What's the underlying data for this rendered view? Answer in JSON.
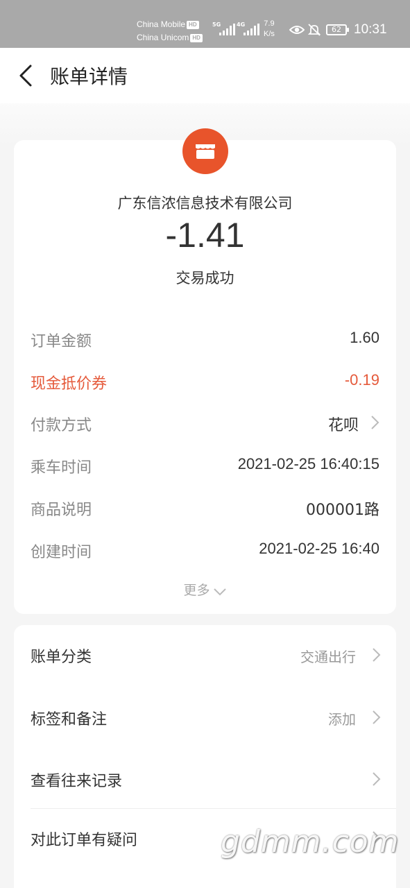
{
  "status_bar": {
    "carrier1": "China Mobile",
    "carrier2": "China Unicom",
    "hd": "HD",
    "net1": "5G",
    "net2": "4G",
    "speed_value": "7.9",
    "speed_unit": "K/s",
    "battery": "62",
    "time": "10:31"
  },
  "nav": {
    "title": "账单详情"
  },
  "bill": {
    "merchant": "广东信浓信息技术有限公司",
    "amount": "-1.41",
    "status": "交易成功",
    "details": [
      {
        "label": "订单金额",
        "value": "1.60"
      },
      {
        "label": "现金抵价券",
        "value": "-0.19"
      },
      {
        "label": "付款方式",
        "value": "花呗"
      },
      {
        "label": "乘车时间",
        "value": "2021-02-25 16:40:15"
      },
      {
        "label": "商品说明",
        "value": "000001路"
      },
      {
        "label": "创建时间",
        "value": "2021-02-25 16:40"
      }
    ],
    "more": "更多"
  },
  "actions": {
    "category": {
      "label": "账单分类",
      "value": "交通出行"
    },
    "tags": {
      "label": "标签和备注",
      "value": "添加"
    },
    "history": {
      "label": "查看往来记录"
    },
    "question": {
      "label": "对此订单有疑问"
    }
  },
  "watermark": "gdmm.com",
  "colors": {
    "accent_red": "#e55a3b",
    "merchant_logo": "#e8542b",
    "status_bar_bg": "#a9a9a9"
  }
}
